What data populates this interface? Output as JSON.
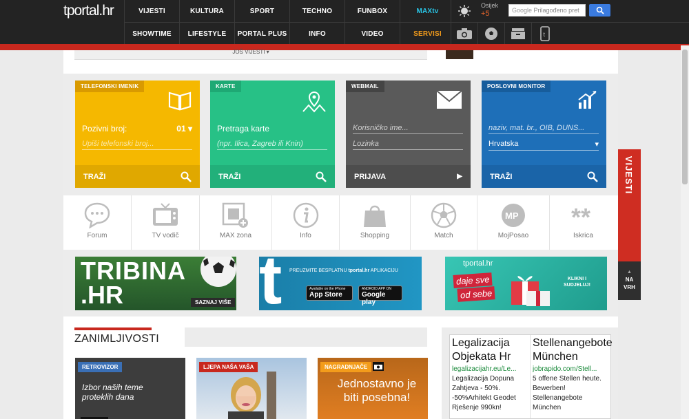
{
  "brand": {
    "logo": "tportal.hr"
  },
  "nav": {
    "row1": [
      "VIJESTI",
      "KULTURA",
      "SPORT",
      "TECHNO",
      "FUNBOX",
      "MAXtv"
    ],
    "row2": [
      "SHOWTIME",
      "LIFESTYLE",
      "PORTAL PLUS",
      "INFO",
      "VIDEO",
      "SERVISI"
    ]
  },
  "weather": {
    "city": "Osijek",
    "temp": "+5"
  },
  "search": {
    "google": "Google",
    "placeholder": "Prilagođeno pret"
  },
  "more_news": "JOŠ VIJESTI",
  "widgets": [
    {
      "tag": "TELEFONSKI IMENIK",
      "field1_label": "Pozivni broj:",
      "field1_value": "01",
      "field2": "Upiši telefonski broj...",
      "action": "TRAŽI"
    },
    {
      "tag": "KARTE",
      "field1_label": "Pretraga karte",
      "field2": "(npr. Ilica, Zagreb ili Knin)",
      "action": "TRAŽI"
    },
    {
      "tag": "WEBMAIL",
      "field1_label": "Korisničko ime...",
      "field2": "Lozinka",
      "action": "PRIJAVA"
    },
    {
      "tag": "POSLOVNI MONITOR",
      "field1_label": "naziv, mat. br., OIB, DUNS...",
      "field2": "Hrvatska",
      "action": "TRAŽI"
    }
  ],
  "services": [
    "Forum",
    "TV vodič",
    "MAX zona",
    "Info",
    "Shopping",
    "Match",
    "MojPosao",
    "Iskrica"
  ],
  "banners": {
    "tribina": {
      "line1": "TRIBINA",
      ".hr": ".HR",
      "cta": "SAZNAJ VIŠE"
    },
    "app": {
      "text1": "PREUZMITE BESPLATNU",
      "text2": "tportal.hr",
      "text3": "APLIKACIJU",
      "store1_small": "Available on the iPhone",
      "store1": "App Store",
      "store2_small": "ANDROID APP ON",
      "store2": "Google play"
    },
    "gift": {
      "logo": "tportal.hr",
      "line1": "daje sve",
      "line2": "od sebe",
      "cta1": "KLIKNI I",
      "cta2": "SUDJELUJ!"
    }
  },
  "section": {
    "title": "ZANIMLJIVOSTI"
  },
  "cards": [
    {
      "tag": "RETROVIZOR",
      "text": "Izbor naših teme proteklih dana"
    },
    {
      "tag": "LJEPA NAŠA VAŠA"
    },
    {
      "tag": "NAGRADNJAČE",
      "text": "Jednostavno je biti posebna!"
    }
  ],
  "ad": {
    "col1": {
      "title": "Legalizacija Objekata Hr",
      "url": "legalizacijahr.eu/Le...",
      "text": "Legalizacija Dopuna Zahtjeva - 50%. -50%Arhitekt Geodet Rješenje 990kn!"
    },
    "col2": {
      "title": "Stellenangebote München",
      "url": "jobrapido.com/Stell...",
      "text": "5 offene Stellen heute. Bewerben! Stellenangebote München"
    }
  },
  "side": {
    "vijesti": "VIJESTI",
    "totop1": "NA",
    "totop2": "VRH"
  },
  "colors": {
    "red": "#c8281e",
    "yellow": "#f5b800",
    "green": "#27c186",
    "grey": "#5a5a5a",
    "blue": "#1e6fb8"
  }
}
